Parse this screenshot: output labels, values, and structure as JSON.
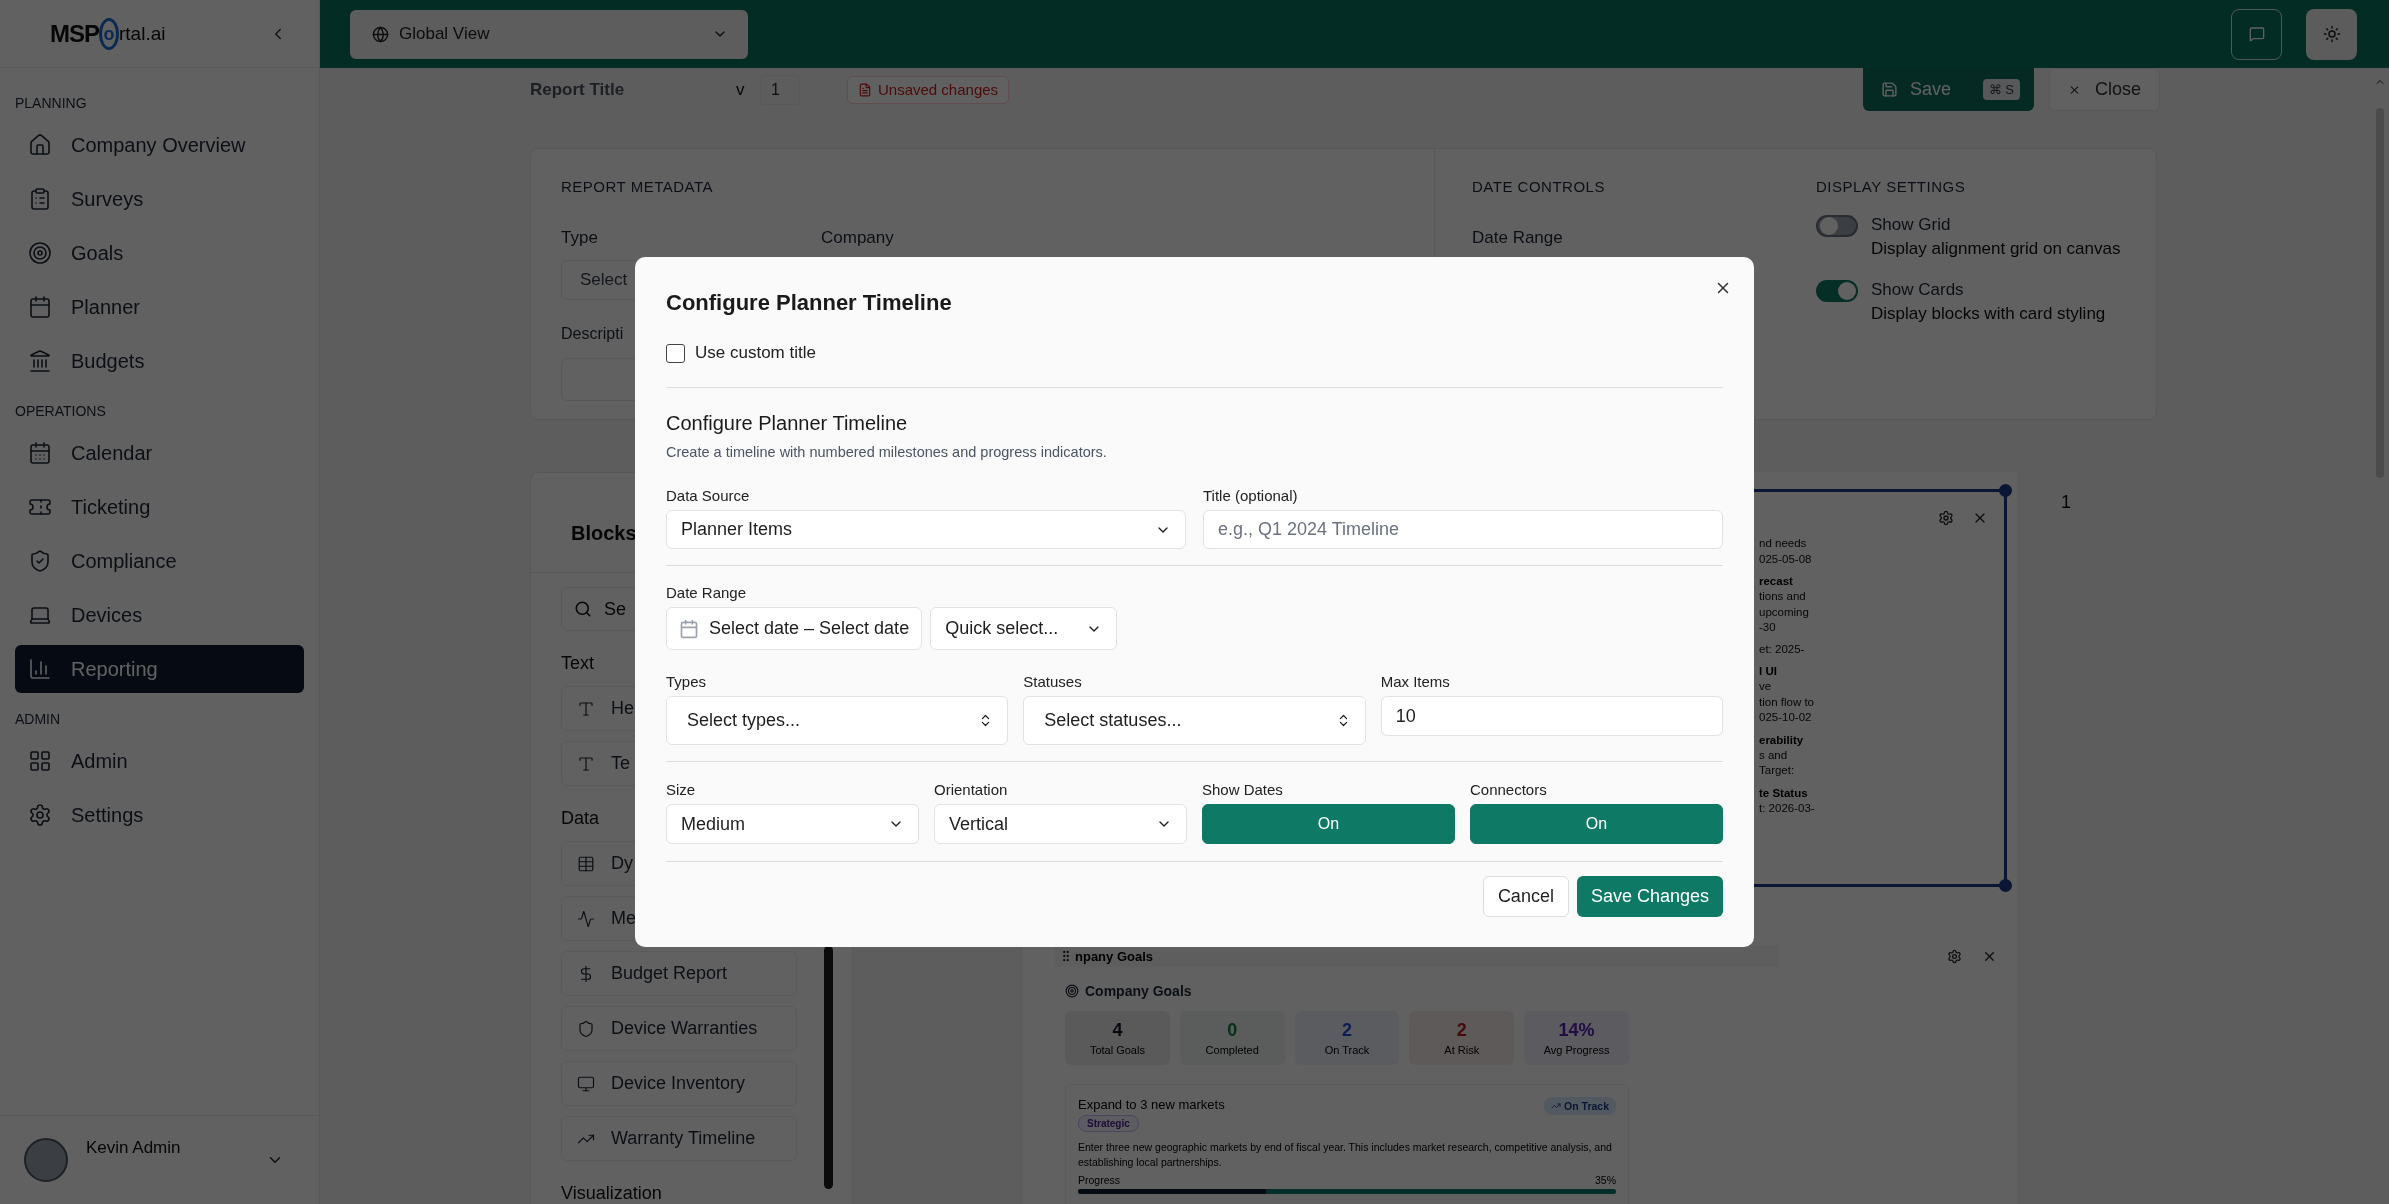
{
  "topbar": {
    "scope": "Global View"
  },
  "sidebar": {
    "logo": {
      "prefix": "MSP",
      "mark": "o",
      "suffix": "rtal.ai"
    },
    "sections": [
      {
        "title": "PLANNING",
        "items": [
          {
            "label": "Company Overview",
            "selected": false
          },
          {
            "label": "Surveys",
            "selected": false
          },
          {
            "label": "Goals",
            "selected": false
          },
          {
            "label": "Planner",
            "selected": false
          },
          {
            "label": "Budgets",
            "selected": false
          }
        ]
      },
      {
        "title": "OPERATIONS",
        "items": [
          {
            "label": "Calendar",
            "selected": false
          },
          {
            "label": "Ticketing",
            "selected": false
          },
          {
            "label": "Compliance",
            "selected": false
          },
          {
            "label": "Devices",
            "selected": false
          },
          {
            "label": "Reporting",
            "selected": true
          }
        ]
      },
      {
        "title": "ADMIN",
        "items": [
          {
            "label": "Admin",
            "selected": false
          },
          {
            "label": "Settings",
            "selected": false
          }
        ]
      }
    ],
    "user": {
      "name": "Kevin Admin"
    }
  },
  "header": {
    "title": "Report Title",
    "version_label": "v",
    "version": "1",
    "status": "Unsaved changes",
    "save": "Save",
    "shortcut": "⌘ S",
    "close": "Close"
  },
  "metadata": {
    "heading": "REPORT METADATA",
    "type_label": "Type",
    "type_value": "Select",
    "company_label": "Company",
    "description_label": "Descripti"
  },
  "date_controls": {
    "heading": "DATE CONTROLS",
    "range_label": "Date Range"
  },
  "display_settings": {
    "heading": "DISPLAY SETTINGS",
    "toggles": [
      {
        "label": "Show Grid",
        "description": "Display alignment grid on canvas",
        "on": false
      },
      {
        "label": "Show Cards",
        "description": "Display blocks with card styling",
        "on": true
      }
    ]
  },
  "blocks": {
    "title": "Blocks",
    "search_placeholder": "Se",
    "groups": [
      {
        "title": "Text",
        "items": [
          "He",
          "Te"
        ]
      },
      {
        "title": "Data",
        "items": [
          "Dy",
          "Me",
          "Budget Report",
          "Device Warranties",
          "Device Inventory",
          "Warranty Timeline"
        ]
      },
      {
        "title": "Visualization"
      }
    ]
  },
  "canvas": {
    "page_number": "1",
    "timeline_fragments": [
      {
        "lines": [
          "nd needs",
          "025-05-08"
        ]
      },
      {
        "title": "recast",
        "lines": [
          "tions and",
          "upcoming",
          "-30"
        ]
      },
      {
        "lines": [
          "et: 2025-"
        ]
      },
      {
        "title": "l UI",
        "lines": [
          "ve",
          "tion flow to",
          "025-10-02"
        ]
      },
      {
        "title": "erability",
        "lines": [
          "s and",
          "Target:"
        ]
      },
      {
        "title": "te Status",
        "lines": [
          "t: 2026-03-"
        ]
      }
    ],
    "goals_block": {
      "header": "npany Goals",
      "title": "Company Goals",
      "stats": [
        {
          "value": "4",
          "label": "Total Goals",
          "kind": "total"
        },
        {
          "value": "0",
          "label": "Completed",
          "kind": "completed"
        },
        {
          "value": "2",
          "label": "On Track",
          "kind": "on_track"
        },
        {
          "value": "2",
          "label": "At Risk",
          "kind": "at_risk"
        },
        {
          "value": "14%",
          "label": "Avg Progress",
          "kind": "average"
        }
      ],
      "goal": {
        "title": "Expand to 3 new markets",
        "tag": "Strategic",
        "status": "On Track",
        "description": "Enter three new geographic markets by end of fiscal year. This includes market research, competitive analysis, and establishing local partnerships.",
        "progress_label": "Progress",
        "progress_value": "35%",
        "level": 0.35
      }
    }
  },
  "modal": {
    "title": "Configure Planner Timeline",
    "custom_title": {
      "label": "Use custom title",
      "checked": false
    },
    "section_title": "Configure Planner Timeline",
    "section_subtitle": "Create a timeline with numbered milestones and progress indicators.",
    "data_source": {
      "label": "Data Source",
      "value": "Planner Items"
    },
    "title_field": {
      "label": "Title (optional)",
      "placeholder": "e.g., Q1 2024 Timeline"
    },
    "date_range": {
      "label": "Date Range",
      "value": "Select date – Select date",
      "quick_select": "Quick select..."
    },
    "types": {
      "label": "Types",
      "value": "Select types..."
    },
    "statuses": {
      "label": "Statuses",
      "value": "Select statuses..."
    },
    "max_items": {
      "label": "Max Items",
      "value": "10"
    },
    "size": {
      "label": "Size",
      "value": "Medium"
    },
    "orientation": {
      "label": "Orientation",
      "value": "Vertical"
    },
    "toggles": [
      {
        "label": "Show Dates",
        "value": "On",
        "on": true
      },
      {
        "label": "Connectors",
        "value": "On",
        "on": true
      }
    ],
    "cancel": "Cancel",
    "save": "Save Changes"
  }
}
